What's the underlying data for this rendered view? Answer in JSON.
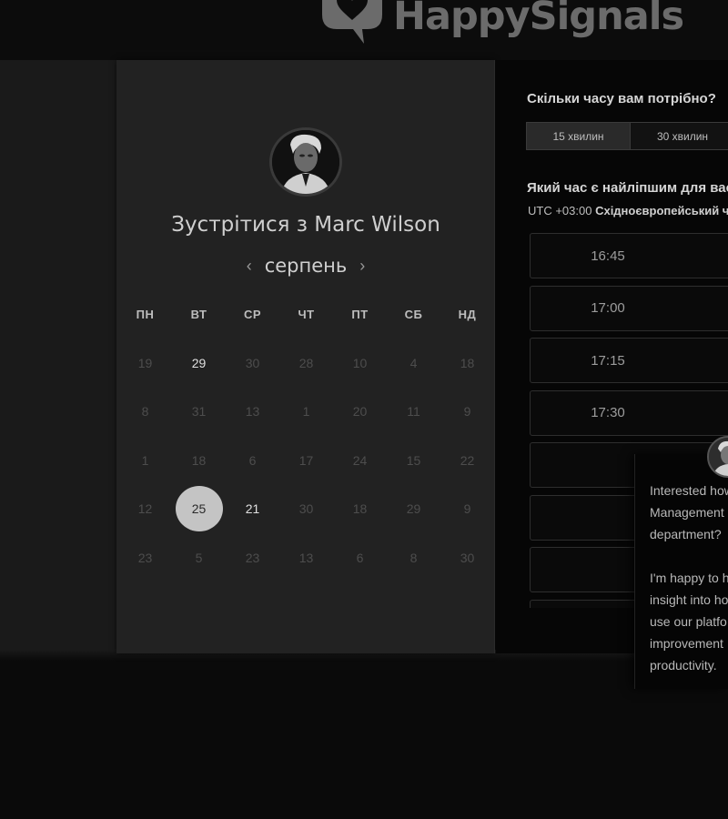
{
  "brand": {
    "name": "HappySignals"
  },
  "calendar": {
    "title": "Зустрітися з Marc Wilson",
    "month": "серпень",
    "prev_arrow": "‹",
    "next_arrow": "›",
    "weekdays": [
      "ПН",
      "ВТ",
      "СР",
      "ЧТ",
      "ПТ",
      "СБ",
      "НД"
    ],
    "weeks": [
      [
        "19",
        "29",
        "30",
        "28",
        "10",
        "4",
        "18"
      ],
      [
        "8",
        "31",
        "13",
        "1",
        "20",
        "11",
        "9"
      ],
      [
        "1",
        "18",
        "6",
        "17",
        "24",
        "15",
        "22"
      ],
      [
        "12",
        "25",
        "21",
        "30",
        "18",
        "29",
        "9"
      ],
      [
        "23",
        "5",
        "23",
        "13",
        "6",
        "8",
        "30"
      ]
    ],
    "available_days": [
      "29",
      "21"
    ],
    "selected_day": "25"
  },
  "scheduler": {
    "duration_question": "Скільки часу вам потрібно?",
    "durations": [
      "15 хвилин",
      "30 хвилин"
    ],
    "time_question": "Який час є найліпшим для вас?",
    "timezone_prefix": "UTC +03:00",
    "timezone_name": "Східноєвропейський час",
    "slots": [
      "16:45",
      "17:00",
      "17:15",
      "17:30",
      "",
      "",
      "",
      ""
    ]
  },
  "chat_popup": {
    "message": "Interested how\nManagement\ndepartment?\n\nI'm happy to h\ninsight into ho\nuse our platfo\nimprovement\nproductivity."
  },
  "colors": {
    "background": "#0a0a0a",
    "card": "#222222",
    "selected_day": "#c4c4c4"
  }
}
